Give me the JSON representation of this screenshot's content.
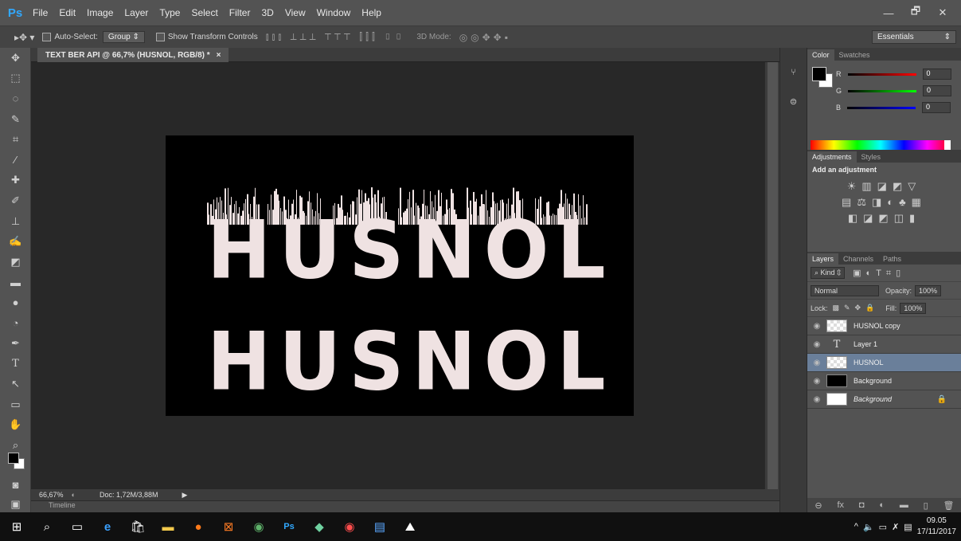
{
  "menubar": {
    "logo": "Ps",
    "items": [
      "File",
      "Edit",
      "Image",
      "Layer",
      "Type",
      "Select",
      "Filter",
      "3D",
      "View",
      "Window",
      "Help"
    ],
    "window_buttons": [
      "—",
      "🗗",
      "✕"
    ]
  },
  "options": {
    "auto_select_label": "Auto-Select:",
    "group_value": "Group",
    "show_transform_label": "Show Transform Controls",
    "mode_3d_label": "3D Mode:",
    "workspace": "Essentials"
  },
  "document": {
    "tab_title": "TEXT BER API @ 66,7% (HUSNOL, RGB/8) *",
    "tab_close": "×",
    "text_top": "HUSNOL",
    "text_bottom": "HUSNOL",
    "zoom": "66,67%",
    "doc_size": "Doc: 1,72M/3,88M",
    "timeline_label": "Timeline"
  },
  "panels": {
    "color_tabs": [
      "Color",
      "Swatches"
    ],
    "r_label": "R",
    "r_value": "0",
    "g_label": "G",
    "g_value": "0",
    "b_label": "B",
    "b_value": "0",
    "adj_tabs": [
      "Adjustments",
      "Styles"
    ],
    "adj_title": "Add an adjustment",
    "layer_tabs": [
      "Layers",
      "Channels",
      "Paths"
    ],
    "kind_label": "Kind",
    "blend_mode": "Normal",
    "opacity_label": "Opacity:",
    "opacity_value": "100%",
    "lock_label": "Lock:",
    "fill_label": "Fill:",
    "fill_value": "100%"
  },
  "layers": [
    {
      "name": "HUSNOL copy",
      "thumb": "checker",
      "selected": false
    },
    {
      "name": "Layer 1",
      "thumb": "type",
      "selected": false
    },
    {
      "name": "HUSNOL",
      "thumb": "checker",
      "selected": true
    },
    {
      "name": "Background",
      "thumb": "black",
      "selected": false
    },
    {
      "name": "Background",
      "thumb": "white",
      "selected": false,
      "locked": true
    }
  ],
  "taskbar": {
    "time": "09.05",
    "date": "17/11/2017"
  },
  "colors": {
    "accent": "#31a8ff",
    "selected_layer": "#6a7f9a",
    "text_fill": "#efe2e2"
  }
}
